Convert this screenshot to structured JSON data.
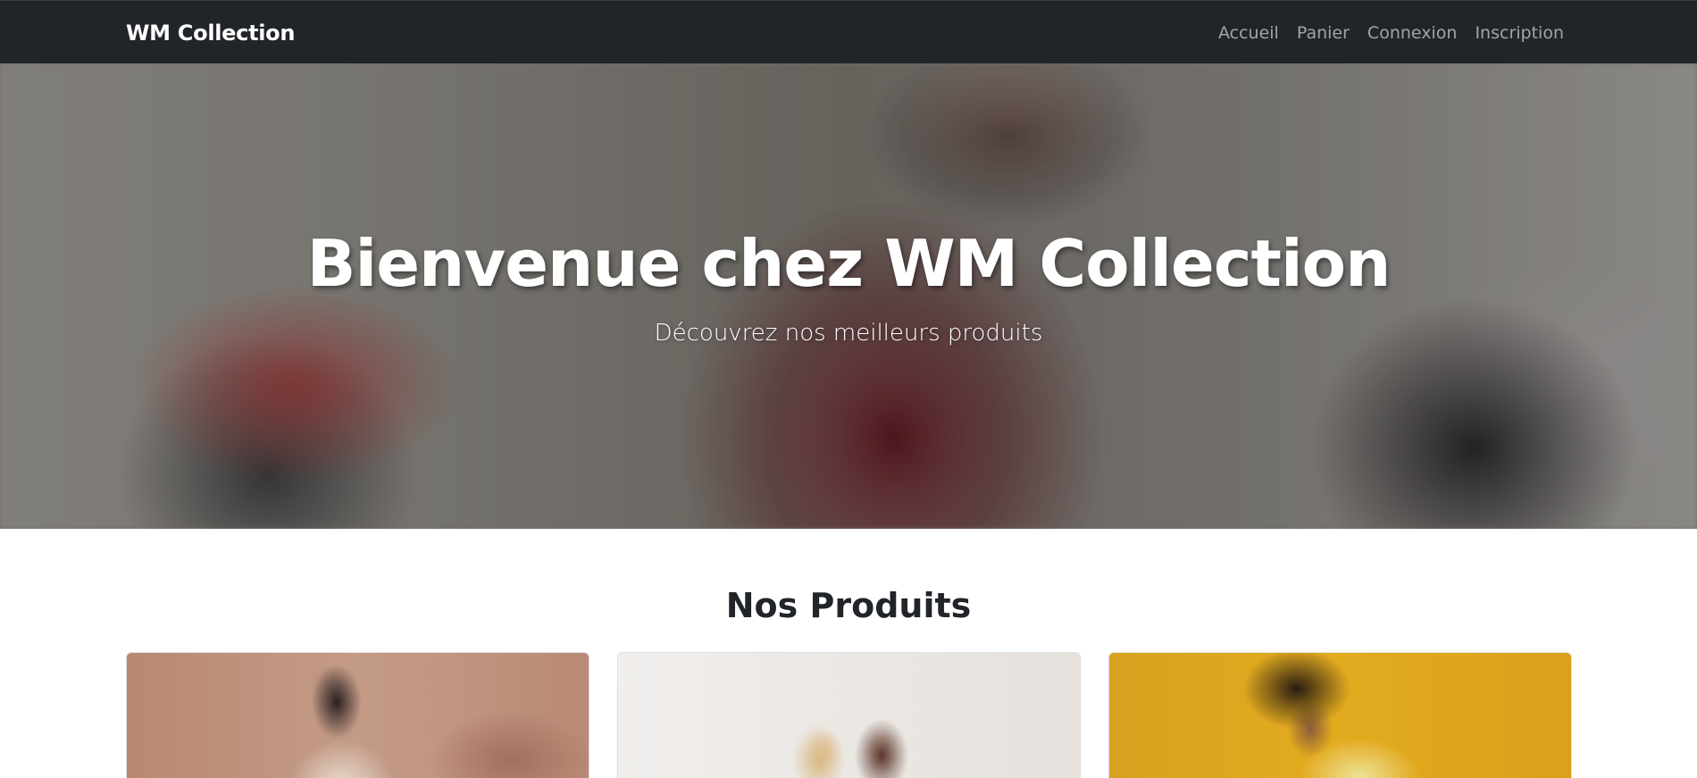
{
  "navbar": {
    "brand": "WM Collection",
    "links": [
      {
        "label": "Accueil"
      },
      {
        "label": "Panier"
      },
      {
        "label": "Connexion"
      },
      {
        "label": "Inscription"
      }
    ]
  },
  "hero": {
    "title": "Bienvenue chez WM Collection",
    "subtitle": "Découvrez nos meilleurs produits"
  },
  "products": {
    "title": "Nos Produits",
    "items": [
      {
        "image": "product-photo-1"
      },
      {
        "image": "product-photo-2"
      },
      {
        "image": "product-photo-3"
      }
    ]
  },
  "colors": {
    "navbar_bg": "#212529",
    "nav_link": "#8f9193",
    "text_dark": "#212529"
  }
}
